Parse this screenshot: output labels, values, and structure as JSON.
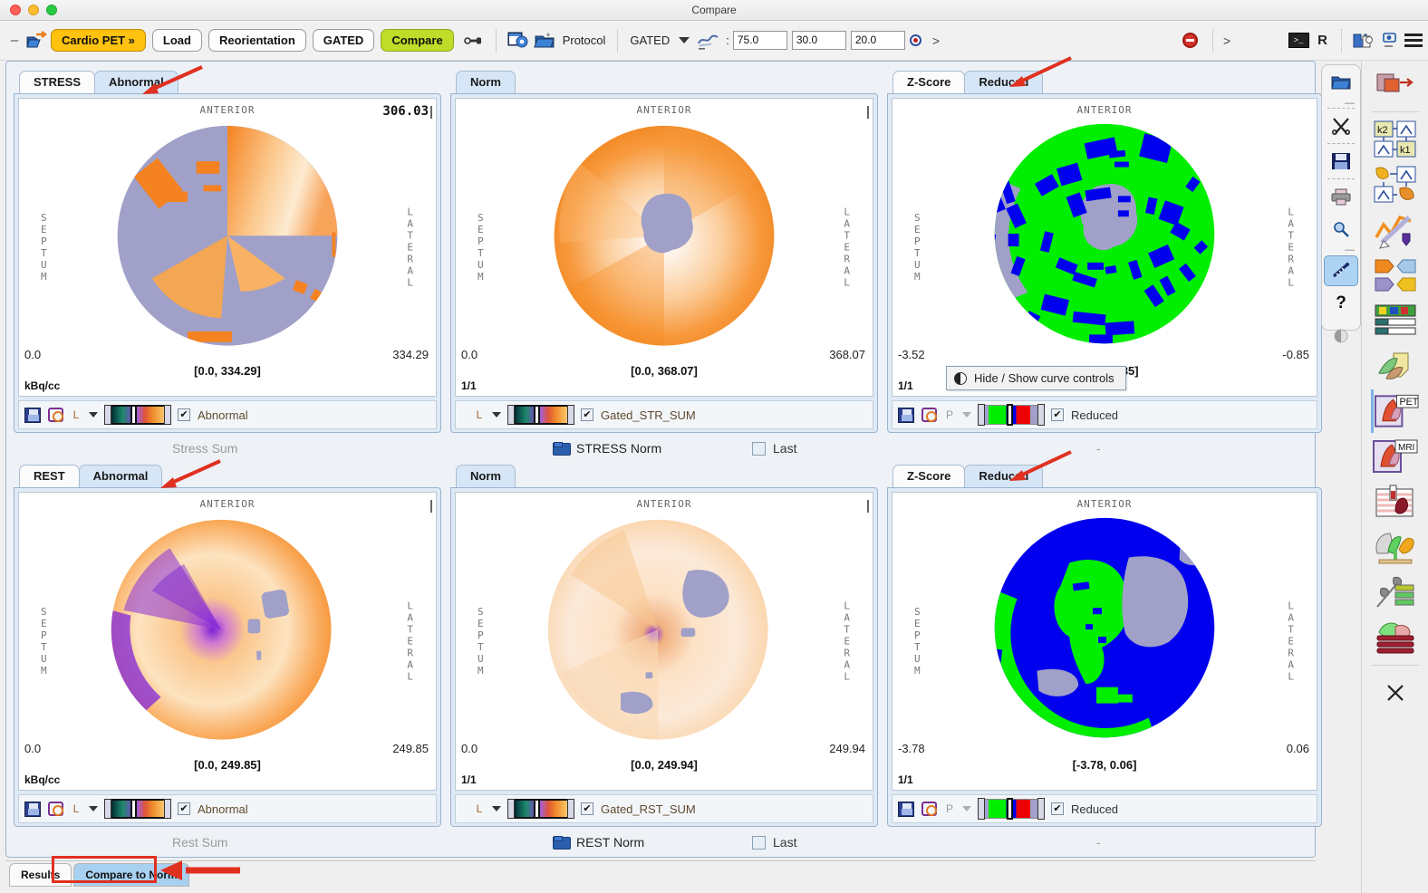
{
  "window": {
    "title": "Compare"
  },
  "toolbar": {
    "minimize": "–",
    "open_icon": "open-folder-arrow-icon",
    "app_button": "Cardio PET »",
    "buttons": [
      "Load",
      "Reorientation",
      "GATED",
      "Compare"
    ],
    "link_icon": "link-icon",
    "settings_icon": "blue-window-gear-icon",
    "protocol_icon": "protocol-folder-icon",
    "protocol_label": "Protocol",
    "mode_label": "GATED",
    "mode_caret": "chevron-down-icon",
    "curve_icon": "curve-icon",
    "colon": ":",
    "fields": [
      "75.0",
      "30.0",
      "20.0"
    ],
    "radio_icon": "radio-target-icon",
    "chevron_right": ">",
    "stop_icon": "stop-icon",
    "gt_symbol": ">",
    "terminal_icon": "terminal-icon",
    "r_logo": "R",
    "plugins_icon": "puzzle-pieces-icon",
    "camera_icon": "camera-icon",
    "menu_icon": "hamburger-menu-icon"
  },
  "panels": {
    "stress": {
      "left": {
        "tabs": [
          {
            "label": "STRESS",
            "active": false
          },
          {
            "label": "Abnormal",
            "active": true
          }
        ],
        "anterior": "ANTERIOR",
        "septum": "SEPTUM",
        "lateral": "LATERAL",
        "topright": "306.03",
        "min": "0.0",
        "max": "334.29",
        "range": "[0.0, 334.29]",
        "unit": "kBq/cc",
        "lut_letter": "L",
        "checkbox_label": "Abnormal",
        "checked": "✔"
      },
      "middle": {
        "tabs": [
          {
            "label": "Norm",
            "active": true
          }
        ],
        "anterior": "ANTERIOR",
        "septum": "SEPTUM",
        "lateral": "LATERAL",
        "min": "0.0",
        "max": "368.07",
        "range": "[0.0, 368.07]",
        "unit": "1/1",
        "lut_letter": "L",
        "checkbox_label": "Gated_STR_SUM",
        "checked": "✔"
      },
      "right": {
        "tabs": [
          {
            "label": "Z-Score",
            "active": false
          },
          {
            "label": "Reduced",
            "active": true
          }
        ],
        "anterior": "ANTERIOR",
        "septum": "SEPTUM",
        "lateral": "LATERAL",
        "min": "-3.52",
        "max": "-0.85",
        "range": "[-3.52, -0.85]",
        "unit": "1/1",
        "lut_letter": "P",
        "checkbox_label": "Reduced",
        "checked": "✔"
      },
      "footer": {
        "sum_label": "Stress Sum",
        "norm_label": "STRESS Norm",
        "last_label": "Last",
        "dash": "-"
      }
    },
    "rest": {
      "left": {
        "tabs": [
          {
            "label": "REST",
            "active": false
          },
          {
            "label": "Abnormal",
            "active": true
          }
        ],
        "anterior": "ANTERIOR",
        "septum": "SEPTUM",
        "lateral": "LATERAL",
        "min": "0.0",
        "max": "249.85",
        "range": "[0.0, 249.85]",
        "unit": "kBq/cc",
        "lut_letter": "L",
        "checkbox_label": "Abnormal",
        "checked": "✔"
      },
      "middle": {
        "tabs": [
          {
            "label": "Norm",
            "active": true
          }
        ],
        "anterior": "ANTERIOR",
        "septum": "SEPTUM",
        "lateral": "LATERAL",
        "min": "0.0",
        "max": "249.94",
        "range": "[0.0, 249.94]",
        "unit": "1/1",
        "lut_letter": "L",
        "checkbox_label": "Gated_RST_SUM",
        "checked": "✔"
      },
      "right": {
        "tabs": [
          {
            "label": "Z-Score",
            "active": false
          },
          {
            "label": "Reduced",
            "active": true
          }
        ],
        "anterior": "ANTERIOR",
        "septum": "SEPTUM",
        "lateral": "LATERAL",
        "min": "-3.78",
        "max": "0.06",
        "range": "[-3.78, 0.06]",
        "unit": "1/1",
        "lut_letter": "P",
        "checkbox_label": "Reduced",
        "checked": "✔"
      },
      "footer": {
        "sum_label": "Rest Sum",
        "norm_label": "REST Norm",
        "last_label": "Last",
        "dash": "-"
      }
    }
  },
  "tooltip": {
    "text": "Hide / Show curve controls",
    "icon": "half-circle-contrast-icon"
  },
  "bottom_tabs": [
    {
      "label": "Results",
      "active": false
    },
    {
      "label": "Compare to Norm",
      "active": true
    }
  ],
  "sidebar_left_icons": [
    "open-folder-icon",
    "scissors-icon",
    "save-icon",
    "printer-icon",
    "zoom-icon",
    "ruler-tool-icon",
    "help-icon",
    "contrast-icon"
  ],
  "sidebar_right_icons": [
    "fusion-registration-icon",
    "k2-k1-parametric-icon",
    "kinetic-model-icon",
    "curve-edit-icon",
    "data-exchange-icon",
    "palette-table-icon",
    "volume-3d-icon",
    "pet-heart-icon",
    "mri-heart-icon",
    "perfusion-heart-icon",
    "brain-icon",
    "tree-chart-icon",
    "stack-icon",
    "close-icon"
  ],
  "sidebar_right_labels": {
    "pet": "PET",
    "mri": "MRI"
  },
  "colors": {
    "accent_amber": "#ffc20e",
    "accent_green": "#bfdd28",
    "tab_active": "#d6e6f7",
    "bottom_tab_active": "#a8d0f0",
    "annotation_red": "#e03020",
    "polar_grey": "#a0a0c8",
    "polar_orange": "#f58220",
    "zscore_green": "#00ee00",
    "zscore_blue": "#0000ee",
    "zscore_red": "#ee0000"
  }
}
